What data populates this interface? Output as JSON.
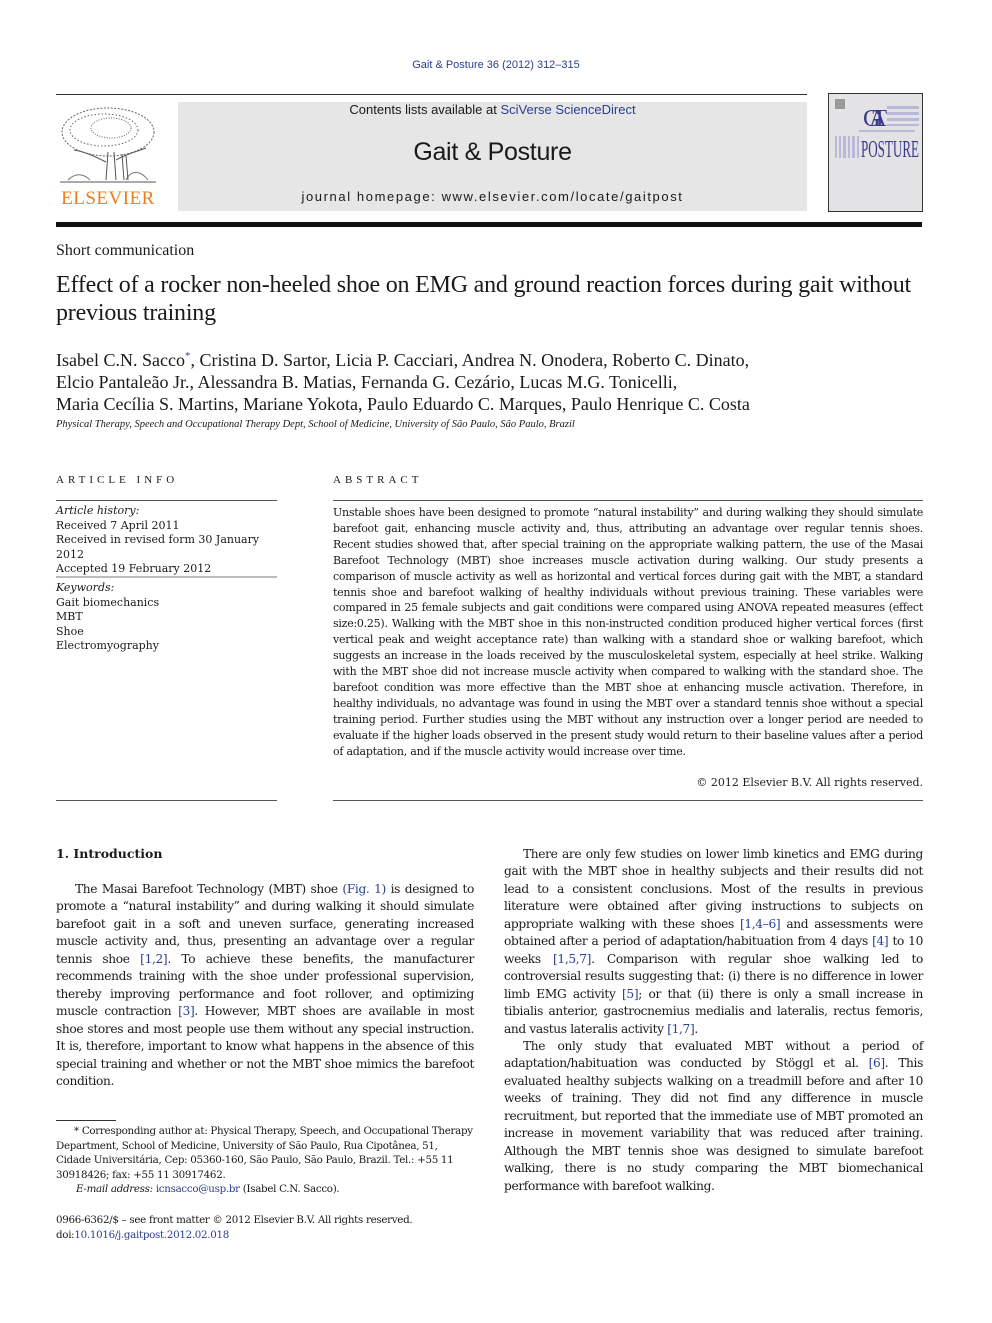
{
  "header": {
    "citation": "Gait & Posture 36 (2012) 312–315",
    "publisher_logo_text": "ELSEVIER",
    "contents_prefix": "Contents lists available at ",
    "contents_link": "SciVerse ScienceDirect",
    "journal_title": "Gait & Posture",
    "homepage": "journal homepage: www.elsevier.com/locate/gaitpost",
    "cover_title_top": "GAIT",
    "cover_title_bottom": "POSTURE"
  },
  "article": {
    "section_type": "Short communication",
    "title": "Effect of a rocker non-heeled shoe on EMG and ground reaction forces during gait without previous training",
    "authors_line1_first": "Isabel C.N. Sacco",
    "authors_line1_mark": "*",
    "authors_line1_rest": ", Cristina D. Sartor, Licia P. Cacciari, Andrea N. Onodera, Roberto C. Dinato,",
    "authors_line2": "Elcio Pantaleão Jr., Alessandra B. Matias, Fernanda G. Cezário, Lucas M.G. Tonicelli,",
    "authors_line3": "Maria Cecília S. Martins, Mariane Yokota, Paulo Eduardo C. Marques, Paulo Henrique C. Costa",
    "affiliation": "Physical Therapy, Speech and Occupational Therapy Dept, School of Medicine, University of São Paulo, São Paulo, Brazil"
  },
  "article_info": {
    "heading": "ARTICLE INFO",
    "history_label": "Article history:",
    "history": [
      "Received 7 April 2011",
      "Received in revised form 30 January 2012",
      "Accepted 19 February 2012"
    ],
    "keywords_label": "Keywords:",
    "keywords": [
      "Gait biomechanics",
      "MBT",
      "Shoe",
      "Electromyography"
    ]
  },
  "abstract": {
    "heading": "ABSTRACT",
    "text": "Unstable shoes have been designed to promote “natural instability” and during walking they should simulate barefoot gait, enhancing muscle activity and, thus, attributing an advantage over regular tennis shoes. Recent studies showed that, after special training on the appropriate walking pattern, the use of the Masai Barefoot Technology (MBT) shoe increases muscle activation during walking. Our study presents a comparison of muscle activity as well as horizontal and vertical forces during gait with the MBT, a standard tennis shoe and barefoot walking of healthy individuals without previous training. These variables were compared in 25 female subjects and gait conditions were compared using ANOVA repeated measures (effect size:0.25). Walking with the MBT shoe in this non-instructed condition produced higher vertical forces (first vertical peak and weight acceptance rate) than walking with a standard shoe or walking barefoot, which suggests an increase in the loads received by the musculoskeletal system, especially at heel strike. Walking with the MBT shoe did not increase muscle activity when compared to walking with the standard shoe. The barefoot condition was more effective than the MBT shoe at enhancing muscle activation. Therefore, in healthy individuals, no advantage was found in using the MBT over a standard tennis shoe without a special training period. Further studies using the MBT without any instruction over a longer period are needed to evaluate if the higher loads observed in the present study would return to their baseline values after a period of adaptation, and if the muscle activity would increase over time.",
    "copyright": "© 2012 Elsevier B.V. All rights reserved."
  },
  "body": {
    "section1_heading": "1.  Introduction",
    "p1": [
      {
        "t": "The Masai Barefoot Technology (MBT) shoe "
      },
      {
        "t": "(Fig. 1)",
        "link": true
      },
      {
        "t": " is designed to promote a “natural instability” and during walking it should simulate barefoot gait in a soft and uneven surface, generating increased muscle activity and, thus, presenting an advantage over a regular tennis shoe "
      },
      {
        "t": "[1,2]",
        "link": true
      },
      {
        "t": ". To achieve these benefits, the manufacturer recommends training with the shoe under professional supervision, thereby improving performance and foot rollover, and optimizing muscle contraction "
      },
      {
        "t": "[3]",
        "link": true
      },
      {
        "t": ". However, MBT shoes are available in most shoe stores and most people use them without any special instruction. It is, therefore, important to know what happens in the absence of this special training and whether or not the MBT shoe mimics the barefoot condition."
      }
    ],
    "p2": [
      {
        "t": "There are only few studies on lower limb kinetics and EMG during gait with the MBT shoe in healthy subjects and their results did not lead to a consistent conclusions. Most of the results in previous literature were obtained after giving instructions to subjects on appropriate walking with these shoes "
      },
      {
        "t": "[1,4–6]",
        "link": true
      },
      {
        "t": " and assessments were obtained after a period of adaptation/habituation from 4 days "
      },
      {
        "t": "[4]",
        "link": true
      },
      {
        "t": " to 10 weeks "
      },
      {
        "t": "[1,5,7]",
        "link": true
      },
      {
        "t": ". Comparison with regular shoe walking led to controversial results suggesting that: (i) there is no difference in lower limb EMG activity "
      },
      {
        "t": "[5]",
        "link": true
      },
      {
        "t": "; or that (ii) there is only a small increase in tibialis anterior, gastrocnemius medialis and lateralis, rectus femoris, and vastus lateralis activity "
      },
      {
        "t": "[1,7]",
        "link": true
      },
      {
        "t": "."
      }
    ],
    "p3": [
      {
        "t": "The only study that evaluated MBT without a period of adaptation/habituation was conducted by Stöggl et al. "
      },
      {
        "t": "[6]",
        "link": true
      },
      {
        "t": ". This evaluated healthy subjects walking on a treadmill before and after 10 weeks of training. They did not find any difference in muscle recruitment, but reported that the immediate use of MBT promoted an increase in movement variability that was reduced after training. Although the MBT tennis shoe was designed to simulate barefoot walking, there is no study comparing the MBT biomechanical performance with barefoot walking."
      }
    ]
  },
  "footnote": {
    "corresponding": "* Corresponding author at: Physical Therapy, Speech, and Occupational Therapy Department, School of Medicine, University of São Paulo, Rua Cipotânea, 51, Cidade Universitária, Cep: 05360-160, São Paulo, São Paulo, Brazil. Tel.: +55 11 30918426; fax: +55 11 30917462.",
    "email_label": "E-mail address:",
    "email": "icnsacco@usp.br",
    "email_suffix": " (Isabel C.N. Sacco).",
    "front_matter": "0966-6362/$ – see front matter © 2012 Elsevier B.V. All rights reserved.",
    "doi_prefix": "doi:",
    "doi": "10.1016/j.gaitpost.2012.02.018"
  },
  "colors": {
    "link": "#2a3f8f",
    "elsevier_orange": "#f07c1a",
    "masthead_bg": "#e6e6e6"
  }
}
